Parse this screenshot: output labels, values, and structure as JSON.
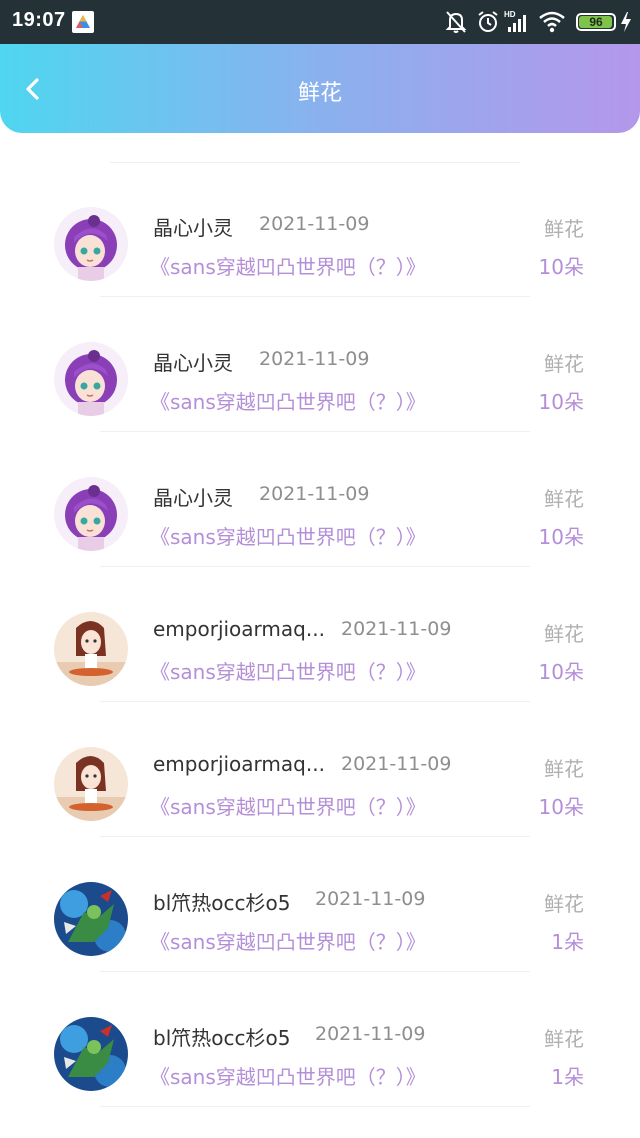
{
  "status_bar": {
    "time": "19:07",
    "battery": "96",
    "battery_level": 0.96,
    "icons": [
      "app-notification-icon",
      "mute-bell-icon",
      "alarm-icon",
      "hd-signal-icon",
      "wifi-icon",
      "battery-icon",
      "charging-icon"
    ]
  },
  "header": {
    "title": "鲜花",
    "back_icon": "chevron-left-icon",
    "gradient": [
      "#4fd6f0",
      "#b497eb"
    ]
  },
  "colors": {
    "accent": "#b48fd8",
    "secondary_text": "#8e8e8e"
  },
  "records": [
    {
      "user": "晶心小灵",
      "date": "2021-11-09",
      "book": "《sans穿越凹凸世界吧（？）》",
      "gift": "鲜花",
      "count": "10朵",
      "avatar": "purple-anime-avatar"
    },
    {
      "user": "晶心小灵",
      "date": "2021-11-09",
      "book": "《sans穿越凹凸世界吧（？）》",
      "gift": "鲜花",
      "count": "10朵",
      "avatar": "purple-anime-avatar"
    },
    {
      "user": "晶心小灵",
      "date": "2021-11-09",
      "book": "《sans穿越凹凸世界吧（？）》",
      "gift": "鲜花",
      "count": "10朵",
      "avatar": "purple-anime-avatar"
    },
    {
      "user": "emporjioarmaq...",
      "date": "2021-11-09",
      "book": "《sans穿越凹凸世界吧（？）》",
      "gift": "鲜花",
      "count": "10朵",
      "avatar": "brown-hair-girl-avatar"
    },
    {
      "user": "emporjioarmaq...",
      "date": "2021-11-09",
      "book": "《sans穿越凹凸世界吧（？）》",
      "gift": "鲜花",
      "count": "10朵",
      "avatar": "brown-hair-girl-avatar"
    },
    {
      "user": "bl笊热occ杉o5",
      "date": "2021-11-09",
      "book": "《sans穿越凹凸世界吧（？）》",
      "gift": "鲜花",
      "count": "1朵",
      "avatar": "game-hero-avatar"
    },
    {
      "user": "bl笊热occ杉o5",
      "date": "2021-11-09",
      "book": "《sans穿越凹凸世界吧（？）》",
      "gift": "鲜花",
      "count": "1朵",
      "avatar": "game-hero-avatar"
    }
  ]
}
